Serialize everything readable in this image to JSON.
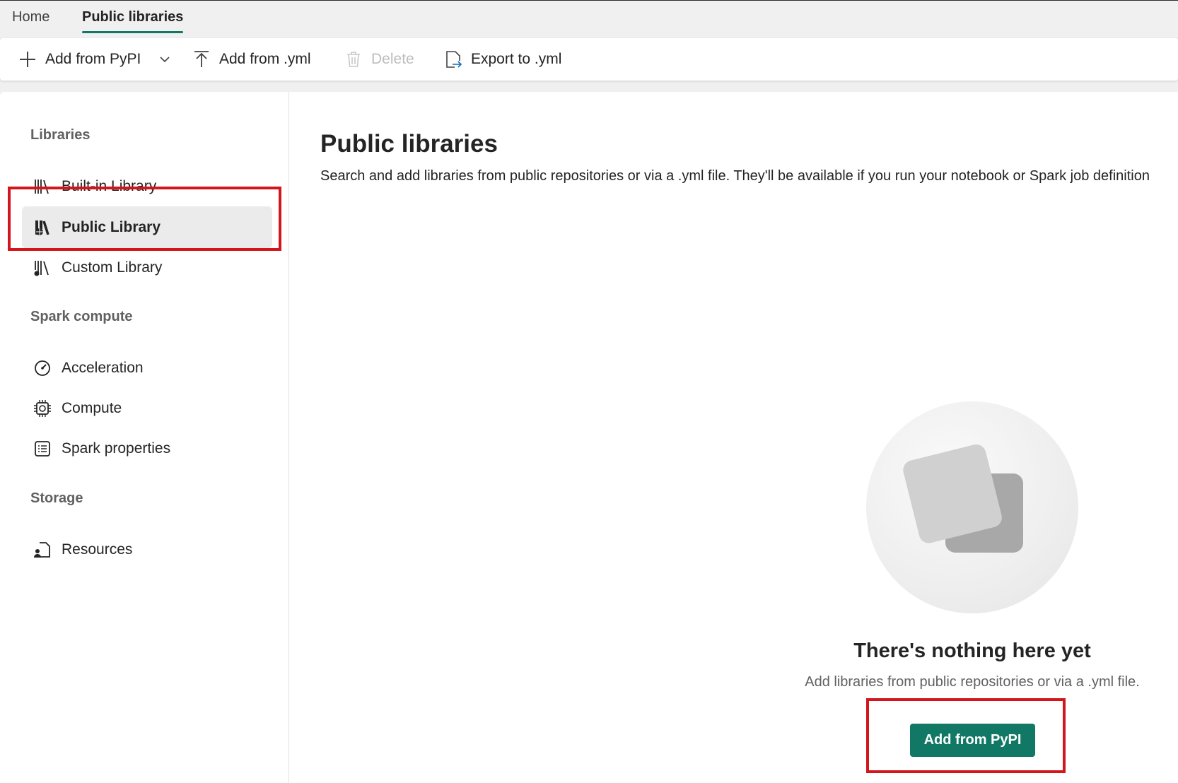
{
  "tabs": [
    {
      "label": "Home",
      "active": false
    },
    {
      "label": "Public libraries",
      "active": true
    }
  ],
  "toolbar": {
    "add_pypi": "Add from PyPI",
    "add_yml": "Add from .yml",
    "delete": "Delete",
    "export_yml": "Export to .yml"
  },
  "sidebar": {
    "sections": [
      {
        "title": "Libraries",
        "items": [
          {
            "label": "Built-in Library",
            "icon": "library-books-icon"
          },
          {
            "label": "Public Library",
            "icon": "public-library-icon",
            "selected": true
          },
          {
            "label": "Custom Library",
            "icon": "custom-library-icon"
          }
        ]
      },
      {
        "title": "Spark compute",
        "items": [
          {
            "label": "Acceleration",
            "icon": "gauge-icon"
          },
          {
            "label": "Compute",
            "icon": "chip-icon"
          },
          {
            "label": "Spark properties",
            "icon": "list-icon"
          }
        ]
      },
      {
        "title": "Storage",
        "items": [
          {
            "label": "Resources",
            "icon": "document-person-icon"
          }
        ]
      }
    ]
  },
  "main": {
    "title": "Public libraries",
    "description": "Search and add libraries from public repositories or via a .yml file. They'll be available if you run your notebook or Spark job definition",
    "empty_state": {
      "title": "There's nothing here yet",
      "description": "Add libraries from public repositories or via a .yml file.",
      "button": "Add from PyPI"
    }
  },
  "colors": {
    "accent": "#117865",
    "highlight": "#d3161c"
  }
}
